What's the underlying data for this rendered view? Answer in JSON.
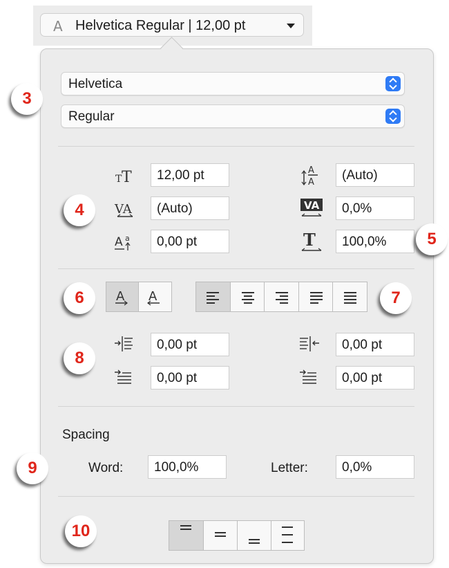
{
  "font_button": {
    "glyph": "A",
    "label": "Helvetica Regular | 12,00 pt"
  },
  "font_family": "Helvetica",
  "font_style": "Regular",
  "character": {
    "size": "12,00 pt",
    "line_height": "(Auto)",
    "kerning": "(Auto)",
    "tracking": "0,0%",
    "baseline_shift": "0,00 pt",
    "horizontal_scale": "100,0%"
  },
  "indents": {
    "left": "0,00 pt",
    "right": "0,00 pt",
    "first_line": "0,00 pt",
    "last_line": "0,00 pt"
  },
  "spacing": {
    "title": "Spacing",
    "word_label": "Word:",
    "word_value": "100,0%",
    "letter_label": "Letter:",
    "letter_value": "0,0%"
  },
  "callouts": [
    "3",
    "4",
    "5",
    "6",
    "7",
    "8",
    "9",
    "10"
  ],
  "colors": {
    "accent": "#2f7bf5",
    "callout": "#e0261b",
    "panel": "#ececec"
  },
  "icons": [
    "font-size-icon",
    "line-height-icon",
    "kerning-icon",
    "tracking-icon",
    "baseline-shift-icon",
    "horizontal-scale-icon",
    "left-indent-icon",
    "right-indent-icon",
    "first-line-indent-icon",
    "last-line-indent-icon"
  ]
}
